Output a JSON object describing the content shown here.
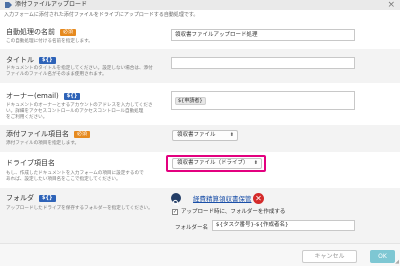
{
  "window": {
    "title": "添付ファイルアップロード",
    "subtitle": "入力フォームに添付された添付ファイルをドライブにアップロードする自動処理です。",
    "close_glyph": "×"
  },
  "fields": {
    "name": {
      "label": "自動処理の名前",
      "badge": "必須",
      "desc": "この自動処理に付ける名前を指定します。",
      "value": "領収書ファイルアップロード処理"
    },
    "title": {
      "label": "タイトル",
      "badge": "${}",
      "desc1": "ドキュメントのタイトルを指定してください。設定しない場合は、添付",
      "desc2": "ファイルのファイル名がそのまま使用されます。",
      "value": ""
    },
    "owner": {
      "label": "オーナー(email)",
      "badge": "${}",
      "desc1": "ドキュメントのオーナーとするアカウントのアドレスを入力してくださ",
      "desc2": "い。詳細をアクセスコントロールのアクセスコントロール自動処理",
      "desc3": "をご利用ください。",
      "chip": "${申請者}"
    },
    "attach_item": {
      "label": "添付ファイル項目名",
      "badge": "必須",
      "desc": "添付ファイルの項目を指定します。",
      "value": "領収書ファイル"
    },
    "drive_item": {
      "label": "ドライブ項目名",
      "desc1": "もし、作成したドキュメントを入力フォームの項目に設定するので",
      "desc2": "あれば、設定したい項目名をここで指定してください。",
      "value": "領収書ファイル（ドライブ）"
    },
    "folder": {
      "label": "フォルダ",
      "badge": "${}",
      "desc": "アップロードしたドライブを保存するフォルダーを指定してください。",
      "folder_name": "経費精算領収書保管",
      "checkbox_label": "アップロード時に、フォルダーを作成する",
      "checkbox_checked": true,
      "fname_label": "フォルダー名",
      "fname_value": "${タスク番号}-${作成者名}"
    }
  },
  "footer": {
    "cancel_label": "キャンセル",
    "ok_label": "OK"
  },
  "icons": {
    "title": "tag-icon",
    "search": "search-icon",
    "delete": "delete-icon",
    "select_arrow": "chevron-updown-icon",
    "resize": "resize-grip-icon"
  },
  "colors": {
    "required_badge": "#e68a1f",
    "variable_badge": "#2e63b8",
    "highlight": "#e3007f",
    "ok_button": "#7ec7d3",
    "folder_link": "#1a4fa8",
    "delete_icon": "#d42a2a"
  }
}
